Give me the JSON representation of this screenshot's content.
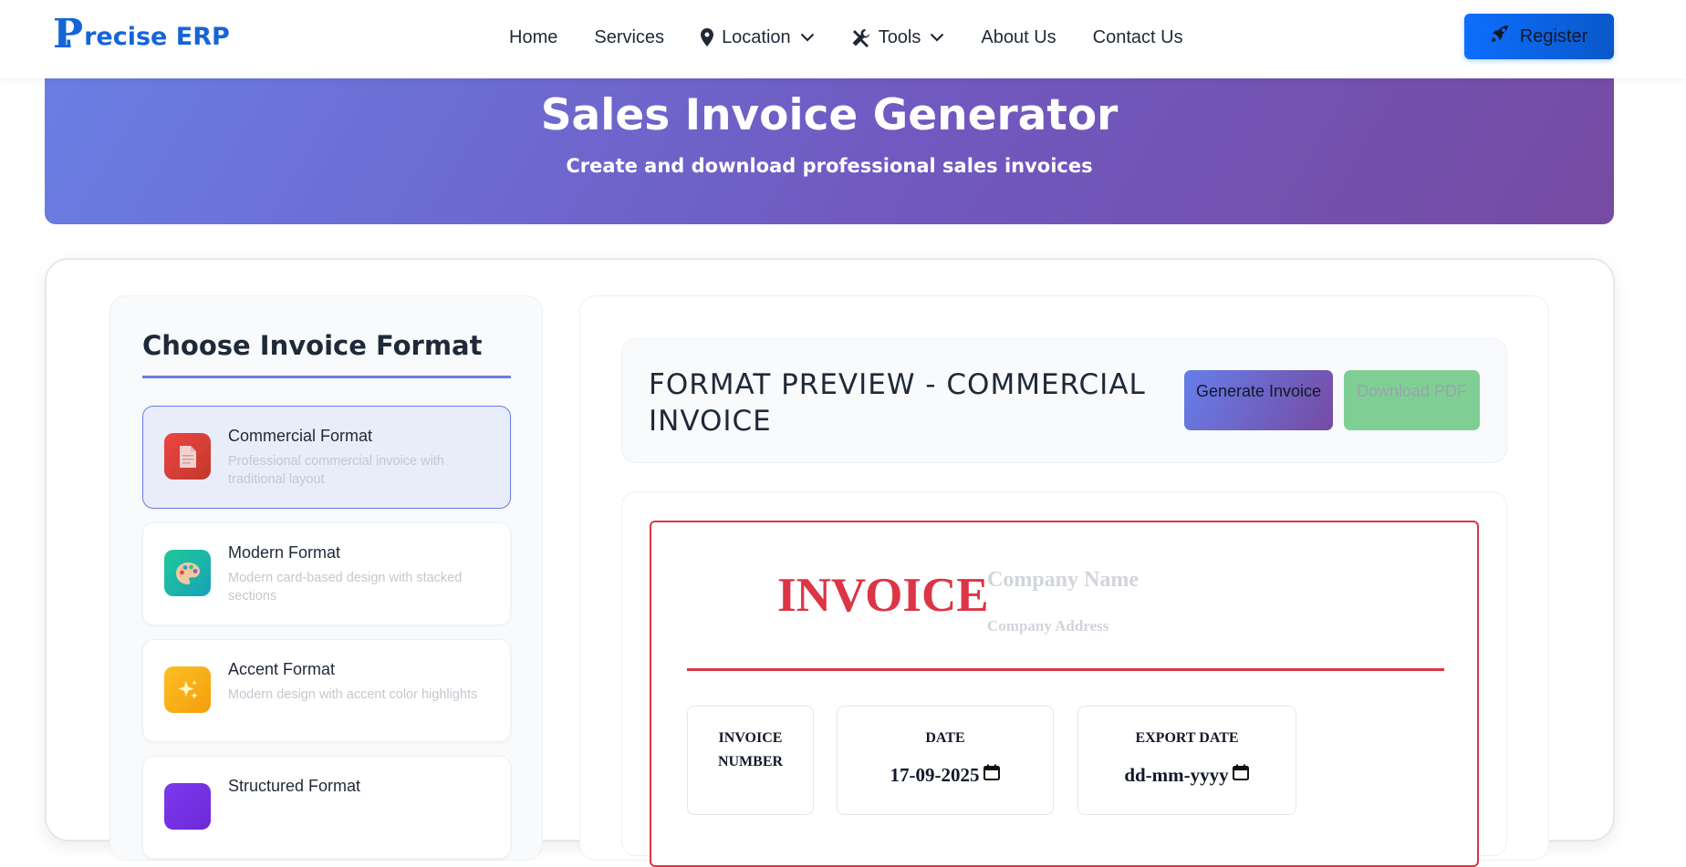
{
  "brand": {
    "logo_letter": "P",
    "logo_text": "recise ERP",
    "color": "#1565d8"
  },
  "nav": {
    "items": [
      {
        "label": "Home",
        "icon": null,
        "dropdown": false
      },
      {
        "label": "Services",
        "icon": null,
        "dropdown": false
      },
      {
        "label": "Location",
        "icon": "map-marker-icon",
        "dropdown": true
      },
      {
        "label": "Tools",
        "icon": "tools-icon",
        "dropdown": true
      },
      {
        "label": "About Us",
        "icon": null,
        "dropdown": false
      },
      {
        "label": "Contact Us",
        "icon": null,
        "dropdown": false
      }
    ],
    "register_label": "Register",
    "register_icon": "rocket-icon"
  },
  "hero": {
    "title": "Sales Invoice Generator",
    "subtitle": "Create and download professional sales invoices"
  },
  "formats": {
    "heading": "Choose Invoice Format",
    "items": [
      {
        "title": "Commercial Format",
        "desc": "Professional commercial invoice with traditional layout",
        "icon": "document-icon",
        "active": true
      },
      {
        "title": "Modern Format",
        "desc": "Modern card-based design with stacked sections",
        "icon": "palette-icon",
        "active": false
      },
      {
        "title": "Accent Format",
        "desc": "Modern design with accent color highlights",
        "icon": "sparkles-icon",
        "active": false
      },
      {
        "title": "Structured Format",
        "desc": "",
        "icon": "structured-icon",
        "active": false
      }
    ]
  },
  "preview": {
    "title": "FORMAT PREVIEW - COMMERCIAL INVOICE",
    "generate_label": "Generate Invoice",
    "download_label": "Download PDF"
  },
  "invoice": {
    "title": "INVOICE",
    "company_name_placeholder": "Company Name",
    "company_address_placeholder": "Company Address",
    "accent_color": "#dc3545",
    "fields": [
      {
        "label": "INVOICE NUMBER",
        "value": ""
      },
      {
        "label": "DATE",
        "value": "17-09-2025"
      },
      {
        "label": "EXPORT DATE",
        "value": "dd-mm-yyyy"
      }
    ]
  }
}
